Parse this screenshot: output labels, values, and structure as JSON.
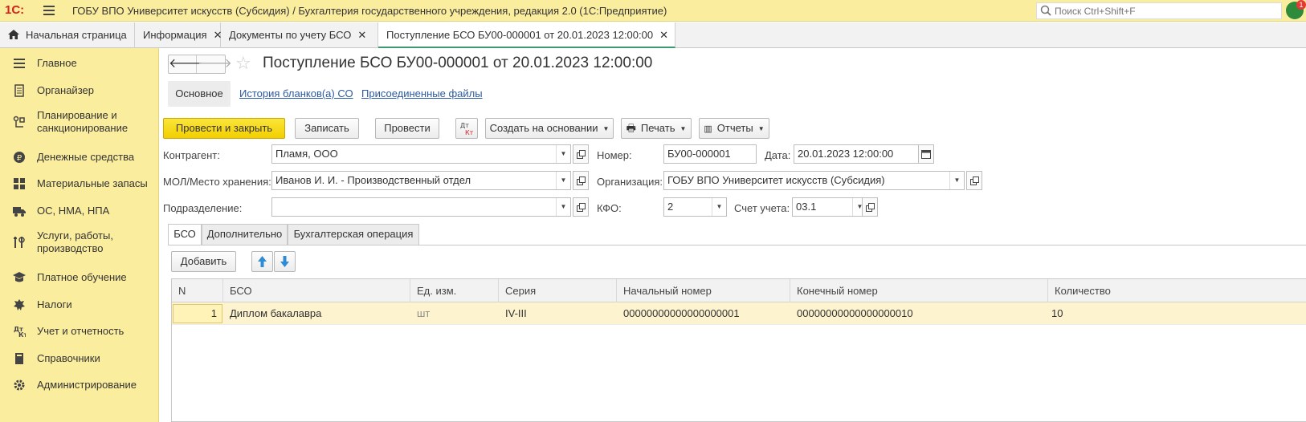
{
  "app": {
    "logo": "1С:",
    "title": "ГОБУ ВПО Университет искусств (Субсидия) / Бухгалтерия государственного учреждения, редакция 2.0  (1С:Предприятие)",
    "search_placeholder": "Поиск Ctrl+Shift+F",
    "notification_count": "1"
  },
  "window_tabs": [
    {
      "label": "Начальная страница"
    },
    {
      "label": "Информация"
    },
    {
      "label": "Документы по учету БСО"
    },
    {
      "label": "Поступление БСО БУ00-000001 от 20.01.2023 12:00:00"
    }
  ],
  "sidebar": {
    "items": [
      {
        "label": "Главное",
        "icon": "menu-lines-icon"
      },
      {
        "label": "Органайзер",
        "icon": "notepad-icon"
      },
      {
        "label": "Планирование и санкционирование",
        "icon": "planning-icon"
      },
      {
        "label": "Денежные средства",
        "icon": "ruble-coin-icon"
      },
      {
        "label": "Материальные запасы",
        "icon": "warehouse-icon"
      },
      {
        "label": "ОС, НМА, НПА",
        "icon": "truck-icon"
      },
      {
        "label": "Услуги, работы, производство",
        "icon": "tools-icon"
      },
      {
        "label": "Платное обучение",
        "icon": "graduation-cap-icon"
      },
      {
        "label": "Налоги",
        "icon": "emblem-icon"
      },
      {
        "label": "Учет и отчетность",
        "icon": "debit-credit-icon"
      },
      {
        "label": "Справочники",
        "icon": "book-icon"
      },
      {
        "label": "Администрирование",
        "icon": "gear-icon"
      }
    ]
  },
  "document": {
    "title": "Поступление БСО БУ00-000001 от 20.01.2023 12:00:00",
    "form_tabs": {
      "main": "Основное",
      "history": "История бланков(а) СО",
      "files": "Присоединенные файлы"
    }
  },
  "toolbar": {
    "post_close": "Провести и закрыть",
    "save": "Записать",
    "post": "Провести",
    "dtkt": "Дт Кт",
    "create_based": "Создать на основании",
    "print": "Печать",
    "reports": "Отчеты"
  },
  "fields": {
    "counterparty_label": "Контрагент:",
    "counterparty": "Пламя, ООО",
    "mol_label": "МОЛ/Место хранения:",
    "mol": "Иванов И. И. - Производственный отдел",
    "division_label": "Подразделение:",
    "division": "",
    "number_label": "Номер:",
    "number": "БУ00-000001",
    "date_label": "Дата:",
    "date": "20.01.2023 12:00:00",
    "org_label": "Организация:",
    "org": "ГОБУ ВПО Университет искусств (Субсидия)",
    "kfo_label": "КФО:",
    "kfo": "2",
    "account_label": "Счет учета:",
    "account": "03.1"
  },
  "inner_tabs": [
    "БСО",
    "Дополнительно",
    "Бухгалтерская операция"
  ],
  "table": {
    "add_button": "Добавить",
    "columns": [
      "N",
      "БСО",
      "Ед. изм.",
      "Серия",
      "Начальный номер",
      "Конечный номер",
      "Количество"
    ],
    "rows": [
      [
        "1",
        "Диплом бакалавра",
        "шт",
        "IV-III",
        "00000000000000000001",
        "00000000000000000010",
        "10"
      ]
    ]
  }
}
